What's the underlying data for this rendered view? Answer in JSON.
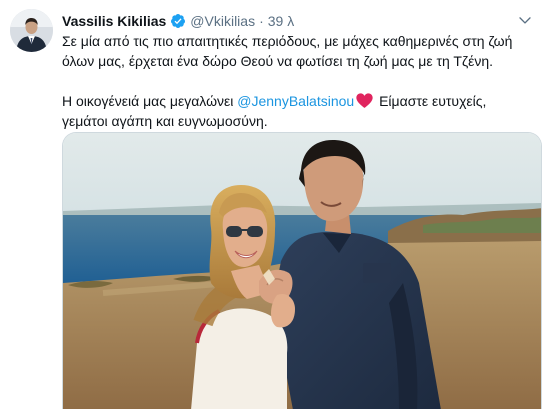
{
  "tweet": {
    "author": {
      "name": "Vassilis Kikilias",
      "handle": "@Vkikilias",
      "verified": true
    },
    "separator": "·",
    "time": "39 λ",
    "text": {
      "line1": "Σε μία από τις πιο απαιτητικές περιόδους, με μάχες καθημερινές στη ζωή",
      "line2": "όλων μας, έρχεται ένα δώρο Θεού να φωτίσει τη ζωή μας με τη Τζένη.",
      "line3_before": "Η οικογένειά μας μεγαλώνει",
      "mention": "@JennyBalatsinou",
      "line3_after": "Είμαστε ευτυχείς,",
      "line4": "γεμάτοι αγάπη και ευγνωμοσύνη."
    },
    "icons": {
      "verified": "verified-badge-icon",
      "heart": "red-heart-emoji-icon",
      "more": "chevron-down-icon"
    },
    "colors": {
      "accent": "#1b95e0",
      "verified": "#1da1f2",
      "heart": "#e0245e",
      "secondary_text": "#5b7083"
    }
  }
}
